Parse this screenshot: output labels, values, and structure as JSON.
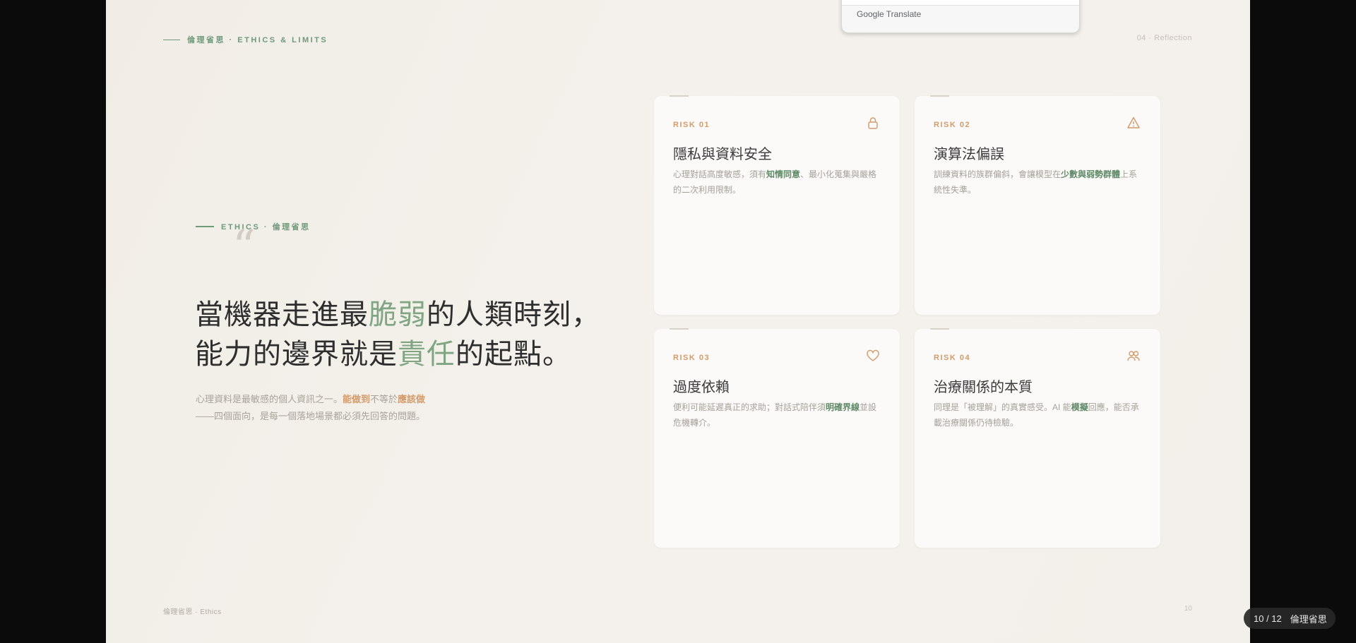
{
  "top": {
    "kicker": "倫理省思 · ETHICS & LIMITS",
    "section": "04 · Reflection"
  },
  "translate_popup": {
    "brand": "Google",
    "label": "Translate"
  },
  "quote": {
    "kicker": "ETHICS · 倫理省思",
    "mark": "“",
    "line1_a": "當機器走進最",
    "line1_accent": "脆弱",
    "line1_b": "的人類時刻，",
    "line2_a": "能力的邊界就是",
    "line2_accent": "責任",
    "line2_b": "的起點。",
    "sub1_a": "心理資料是最敏感的個人資訊之一。",
    "sub1_hl1": "能做到",
    "sub1_b": "不等於",
    "sub1_hl2": "應該做",
    "sub2": "——四個面向，是每一個落地場景都必須先回答的問題。"
  },
  "risks": [
    {
      "label": "RISK 01",
      "icon": "lock-icon",
      "title": "隱私與資料安全",
      "desc_a": "心理對話高度敏感，須有",
      "desc_hl": "知情同意",
      "desc_b": "、最小化蒐集與嚴格的二次利用限制。"
    },
    {
      "label": "RISK 02",
      "icon": "warning-icon",
      "title": "演算法偏誤",
      "desc_a": "訓練資料的族群偏斜，會讓模型在",
      "desc_hl": "少數與弱勢群體",
      "desc_b": "上系統性失準。"
    },
    {
      "label": "RISK 03",
      "icon": "heart-icon",
      "title": "過度依賴",
      "desc_a": "便利可能延遲真正的求助；對話式陪伴須",
      "desc_hl": "明確界線",
      "desc_b": "並設危機轉介。"
    },
    {
      "label": "RISK 04",
      "icon": "users-icon",
      "title": "治療關係的本質",
      "desc_a": "同理是「被理解」的真實感受。AI 能",
      "desc_hl": "模擬",
      "desc_b": "回應，能否承載治療關係仍待檢驗。"
    }
  ],
  "footer": {
    "left": "倫理省思 · Ethics",
    "page_num": "10"
  },
  "pager": {
    "position": "10 / 12",
    "name": "倫理省思"
  },
  "colors": {
    "accent_green": "#6f9a7a",
    "accent_orange": "#d39a6a",
    "background": "#f3efea"
  }
}
